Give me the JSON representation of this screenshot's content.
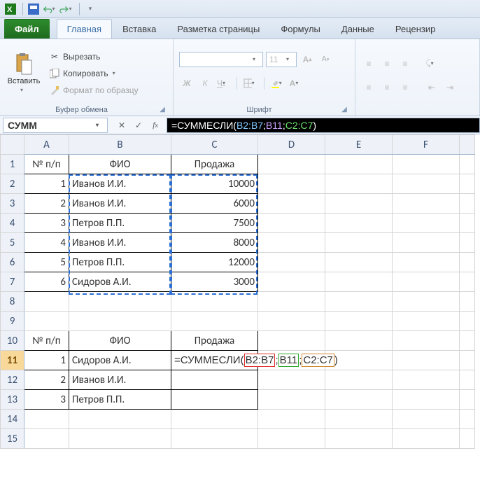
{
  "qat": {
    "items": [
      "excel-icon",
      "save-icon",
      "undo-icon",
      "redo-icon"
    ]
  },
  "tabs": {
    "file": "Файл",
    "items": [
      "Главная",
      "Вставка",
      "Разметка страницы",
      "Формулы",
      "Данные",
      "Рецензир"
    ],
    "active_index": 0
  },
  "ribbon": {
    "clipboard": {
      "paste": "Вставить",
      "cut": "Вырезать",
      "copy": "Копировать",
      "format_painter": "Формат по образцу",
      "group_label": "Буфер обмена"
    },
    "font": {
      "group_label": "Шрифт",
      "font_name": "",
      "font_size": "11"
    }
  },
  "formula_bar": {
    "name_box": "СУММ",
    "formula_prefix": "=СУММЕСЛИ(",
    "ref1": "B2:B7",
    "ref2": "B11",
    "ref3": "C2:C7",
    "sep": ";",
    "suffix": ")"
  },
  "grid": {
    "columns": [
      "A",
      "B",
      "C",
      "D",
      "E",
      "F"
    ],
    "active_row": 11,
    "rows": [
      {
        "n": 1,
        "A": "№ п/п",
        "B": "ФИО",
        "C": "Продажа",
        "hdr": true
      },
      {
        "n": 2,
        "A": "1",
        "B": "Иванов И.И.",
        "C": "10000"
      },
      {
        "n": 3,
        "A": "2",
        "B": "Иванов И.И.",
        "C": "6000"
      },
      {
        "n": 4,
        "A": "3",
        "B": "Петров П.П.",
        "C": "7500"
      },
      {
        "n": 5,
        "A": "4",
        "B": "Иванов И.И.",
        "C": "8000"
      },
      {
        "n": 6,
        "A": "5",
        "B": "Петров П.П.",
        "C": "12000"
      },
      {
        "n": 7,
        "A": "6",
        "B": "Сидоров А.И.",
        "C": "3000"
      },
      {
        "n": 8
      },
      {
        "n": 9
      },
      {
        "n": 10,
        "A": "№ п/п",
        "B": "ФИО",
        "C": "Продажа",
        "hdr": true
      },
      {
        "n": 11,
        "A": "1",
        "B": "Сидоров А.И.",
        "C_formula": true
      },
      {
        "n": 12,
        "A": "2",
        "B": "Иванов И.И."
      },
      {
        "n": 13,
        "A": "3",
        "B": "Петров П.П."
      },
      {
        "n": 14
      },
      {
        "n": 15
      }
    ],
    "formula_display": {
      "prefix": "=СУММЕСЛИ(",
      "r1": "B2:B7",
      "r2": "B11",
      "r3": "C2:C7",
      "sep": ";",
      "suffix": ")"
    }
  },
  "chart_data": {
    "type": "table",
    "title": "Продажа",
    "columns": [
      "№ п/п",
      "ФИО",
      "Продажа"
    ],
    "rows": [
      [
        1,
        "Иванов И.И.",
        10000
      ],
      [
        2,
        "Иванов И.И.",
        6000
      ],
      [
        3,
        "Петров П.П.",
        7500
      ],
      [
        4,
        "Иванов И.И.",
        8000
      ],
      [
        5,
        "Петров П.П.",
        12000
      ],
      [
        6,
        "Сидоров А.И.",
        3000
      ]
    ],
    "summary_rows": [
      [
        1,
        "Сидоров А.И.",
        "=СУММЕСЛИ(B2:B7;B11;C2:C7)"
      ],
      [
        2,
        "Иванов И.И.",
        null
      ],
      [
        3,
        "Петров П.П.",
        null
      ]
    ]
  }
}
